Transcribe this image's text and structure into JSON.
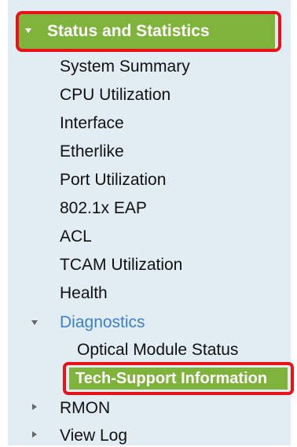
{
  "nav": {
    "section_title": "Status and Statistics",
    "items": [
      {
        "label": "System Summary"
      },
      {
        "label": "CPU Utilization"
      },
      {
        "label": "Interface"
      },
      {
        "label": "Etherlike"
      },
      {
        "label": "Port Utilization"
      },
      {
        "label": "802.1x EAP"
      },
      {
        "label": "ACL"
      },
      {
        "label": "TCAM Utilization"
      },
      {
        "label": "Health"
      }
    ],
    "diagnostics": {
      "label": "Diagnostics",
      "expanded": true,
      "children": [
        {
          "label": "Optical Module Status"
        },
        {
          "label": "Tech-Support Information",
          "selected": true
        }
      ]
    },
    "collapsed_groups": [
      {
        "label": "RMON"
      },
      {
        "label": "View Log"
      }
    ]
  },
  "colors": {
    "panel_background": "#e2ecf3",
    "section_header_green": "#7fb33b",
    "highlight_red": "#e8121b",
    "expanded_link_blue": "#3d7fcb"
  }
}
